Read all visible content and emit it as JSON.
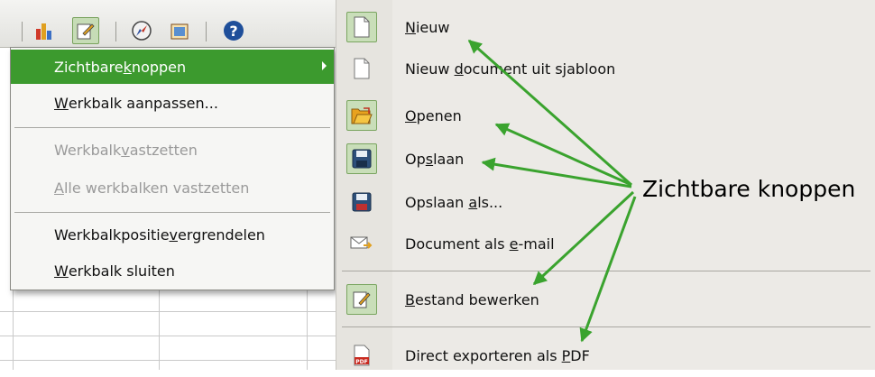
{
  "context_menu": {
    "items": [
      {
        "pre": "Zichtbare ",
        "acc": "k",
        "post": "noppen",
        "state": "highlight",
        "has_submenu": true
      },
      {
        "pre": "",
        "acc": "W",
        "post": "erkbalk aanpassen...",
        "state": "normal"
      },
      {
        "pre": "Werkbalk ",
        "acc": "v",
        "post": "astzetten",
        "state": "disabled"
      },
      {
        "pre": "",
        "acc": "A",
        "post": "lle werkbalken vastzetten",
        "state": "disabled"
      },
      {
        "pre": "Werkbalkpositie ",
        "acc": "v",
        "post": "ergrendelen",
        "state": "normal"
      },
      {
        "pre": "",
        "acc": "W",
        "post": "erkbalk sluiten",
        "state": "normal"
      }
    ]
  },
  "submenu": {
    "items": [
      {
        "pre": "",
        "acc": "N",
        "post": "ieuw",
        "icon": "new-document-icon",
        "checked": true
      },
      {
        "pre": "Nieuw ",
        "acc": "d",
        "post": "ocument uit sjabloon",
        "icon": "template-document-icon",
        "checked": false
      },
      {
        "pre": "",
        "acc": "O",
        "post": "penen",
        "icon": "open-folder-icon",
        "checked": true
      },
      {
        "pre": "Op",
        "acc": "s",
        "post": "laan",
        "icon": "save-icon",
        "checked": true
      },
      {
        "pre": "Opslaan ",
        "acc": "a",
        "post": "ls...",
        "icon": "save-as-icon",
        "checked": false
      },
      {
        "pre": "Document als ",
        "acc": "e",
        "post": "-mail",
        "icon": "email-document-icon",
        "checked": false
      },
      {
        "pre": "",
        "acc": "B",
        "post": "estand bewerken",
        "icon": "edit-file-icon",
        "checked": true
      },
      {
        "pre": "Direct exporteren als ",
        "acc": "P",
        "post": "DF",
        "icon": "pdf-export-icon",
        "checked": false
      }
    ]
  },
  "annotation": {
    "text": "Zichtbare knoppen"
  },
  "colors": {
    "highlight": "#3c9a2e",
    "arrow": "#3aa32e",
    "checked_bg": "#c9deb9"
  }
}
